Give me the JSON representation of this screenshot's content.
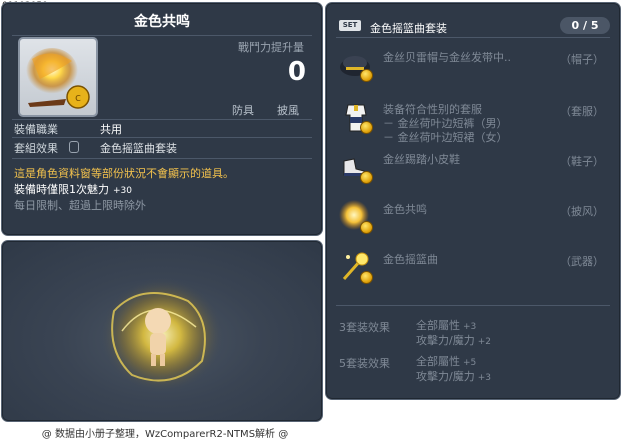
{
  "item_id": "01103050",
  "item": {
    "name": "金色共鸣",
    "power_label": "戰鬥力提升量",
    "power_value": "0",
    "tags": [
      "防具",
      "披風"
    ],
    "job_label": "裝備職業",
    "job_value": "共用",
    "set_label": "套組效果",
    "set_value": "金色摇篮曲套装",
    "desc_notice": "這是角色資料窗等部份狀況不會顯示的道具。",
    "desc_stat": "裝備時僅限1次魅力",
    "desc_stat_value": "+30",
    "desc_limit": "每日限制、超過上限時除外"
  },
  "set": {
    "badge": "SET",
    "name": "金色摇篮曲套装",
    "count": "0 / 5",
    "items": [
      {
        "name": "金丝贝雷帽与金丝发带中..",
        "sub": [],
        "category": "（帽子）",
        "icon": "beret-hat-icon"
      },
      {
        "name": "装备符合性别的套服",
        "sub": [
          "－ 金丝荷叶边短裤（男）",
          "－ 金丝荷叶边短裙（女）"
        ],
        "category": "（套服）",
        "icon": "outfit-icon"
      },
      {
        "name": "金丝踢踏小皮鞋",
        "sub": [],
        "category": "（鞋子）",
        "icon": "tap-shoes-icon"
      },
      {
        "name": "金色共鸣",
        "sub": [],
        "category": "（披风）",
        "icon": "golden-resonance-icon"
      },
      {
        "name": "金色摇篮曲",
        "sub": [],
        "category": "（武器）",
        "icon": "wand-icon"
      }
    ],
    "effects": [
      {
        "label": "3套装效果",
        "lines": [
          {
            "text": "全部屬性",
            "value": "+3"
          },
          {
            "text": "攻擊力/魔力",
            "value": "+2"
          }
        ]
      },
      {
        "label": "5套装效果",
        "lines": [
          {
            "text": "全部屬性",
            "value": "+5"
          },
          {
            "text": "攻擊力/魔力",
            "value": "+3"
          }
        ]
      }
    ]
  },
  "footer": "@ 数据由小册子整理，WzComparerR2-NTMS解析 @",
  "colors": {
    "panel": "#2f3947",
    "accent_text": "#f3c24d",
    "glow": "#f5d23a"
  }
}
